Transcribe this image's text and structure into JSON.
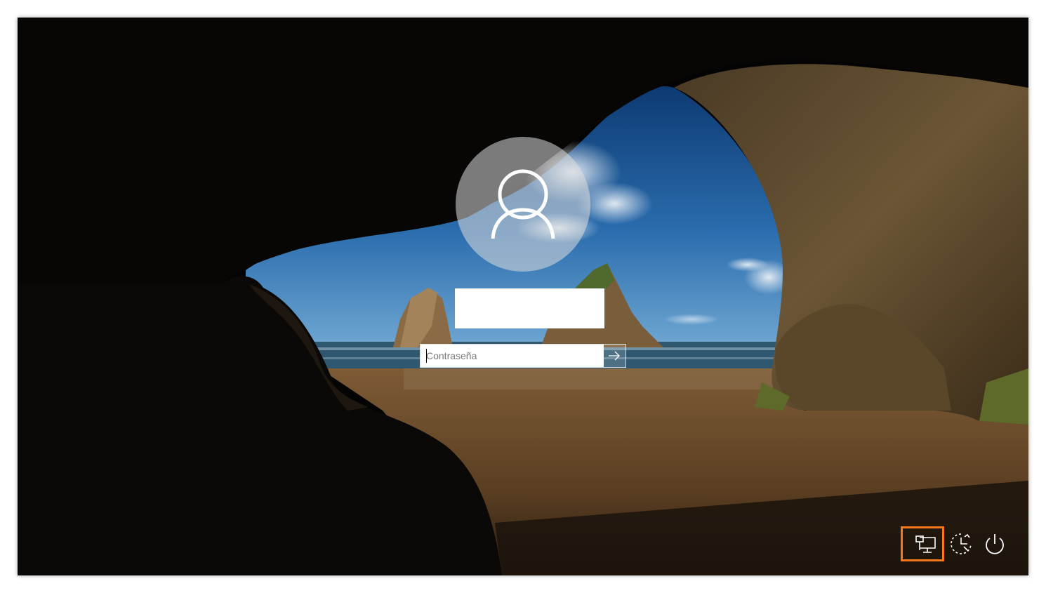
{
  "login": {
    "password_placeholder": "Contraseña",
    "password_value": "",
    "username_value": ""
  },
  "icons": {
    "avatar": "user-silhouette-icon",
    "submit": "arrow-right-icon",
    "network": "network-icon",
    "accessibility": "ease-of-access-icon",
    "power": "power-icon"
  },
  "colors": {
    "highlight": "#f7791c",
    "field_background": "#ffffff",
    "icon_color": "#ffffff"
  }
}
